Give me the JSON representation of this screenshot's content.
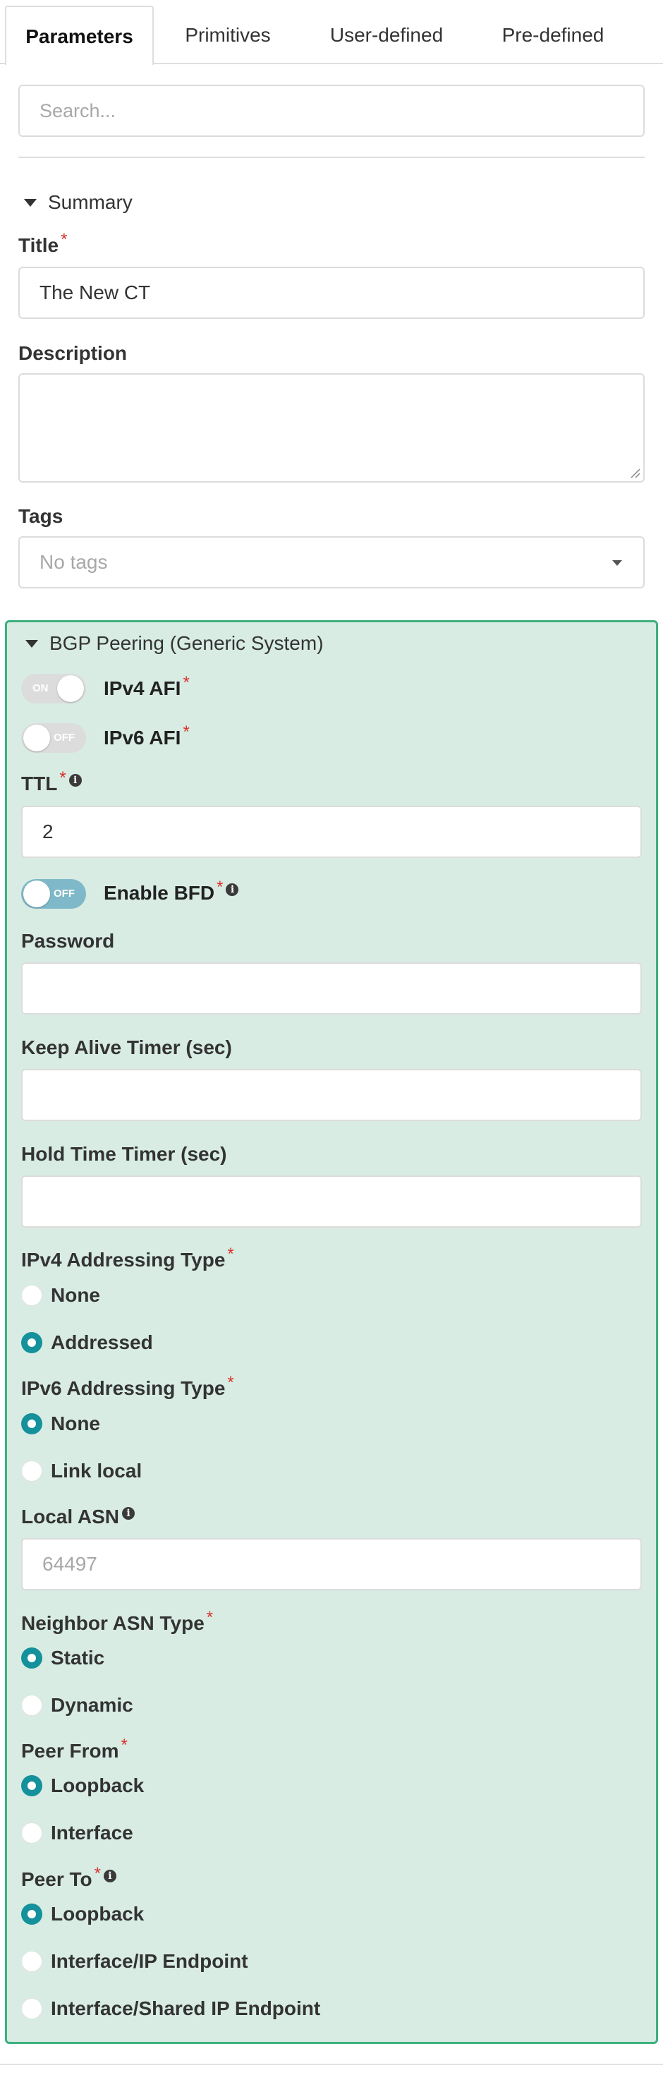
{
  "tabs": [
    {
      "label": "Parameters",
      "active": true
    },
    {
      "label": "Primitives",
      "active": false
    },
    {
      "label": "User-defined",
      "active": false
    },
    {
      "label": "Pre-defined",
      "active": false
    }
  ],
  "search": {
    "placeholder": "Search..."
  },
  "summary": {
    "header": "Summary",
    "title_label": "Title",
    "title_value": "The New CT",
    "description_label": "Description",
    "description_value": "",
    "tags_label": "Tags",
    "tags_placeholder": "No tags"
  },
  "bgp": {
    "header": "BGP Peering (Generic System)",
    "ipv4_afi": {
      "label": "IPv4 AFI",
      "state": "ON"
    },
    "ipv6_afi": {
      "label": "IPv6 AFI",
      "state": "OFF"
    },
    "ttl": {
      "label": "TTL",
      "value": "2"
    },
    "enable_bfd": {
      "label": "Enable BFD",
      "state": "OFF"
    },
    "password": {
      "label": "Password",
      "value": ""
    },
    "keep_alive": {
      "label": "Keep Alive Timer (sec)",
      "value": ""
    },
    "hold_time": {
      "label": "Hold Time Timer (sec)",
      "value": ""
    },
    "ipv4_addressing": {
      "label": "IPv4 Addressing Type",
      "options": [
        "None",
        "Addressed"
      ],
      "selected": "Addressed"
    },
    "ipv6_addressing": {
      "label": "IPv6 Addressing Type",
      "options": [
        "None",
        "Link local"
      ],
      "selected": "None"
    },
    "local_asn": {
      "label": "Local ASN",
      "placeholder": "64497"
    },
    "neighbor_asn": {
      "label": "Neighbor ASN Type",
      "options": [
        "Static",
        "Dynamic"
      ],
      "selected": "Static"
    },
    "peer_from": {
      "label": "Peer From",
      "options": [
        "Loopback",
        "Interface"
      ],
      "selected": "Loopback"
    },
    "peer_to": {
      "label": "Peer To",
      "options": [
        "Loopback",
        "Interface/IP Endpoint",
        "Interface/Shared IP Endpoint"
      ],
      "selected": "Loopback"
    }
  },
  "colors": {
    "panel_bg": "#d8ece4",
    "panel_border": "#3fb07e",
    "radio_checked": "#14919b",
    "required": "#d9312c"
  }
}
